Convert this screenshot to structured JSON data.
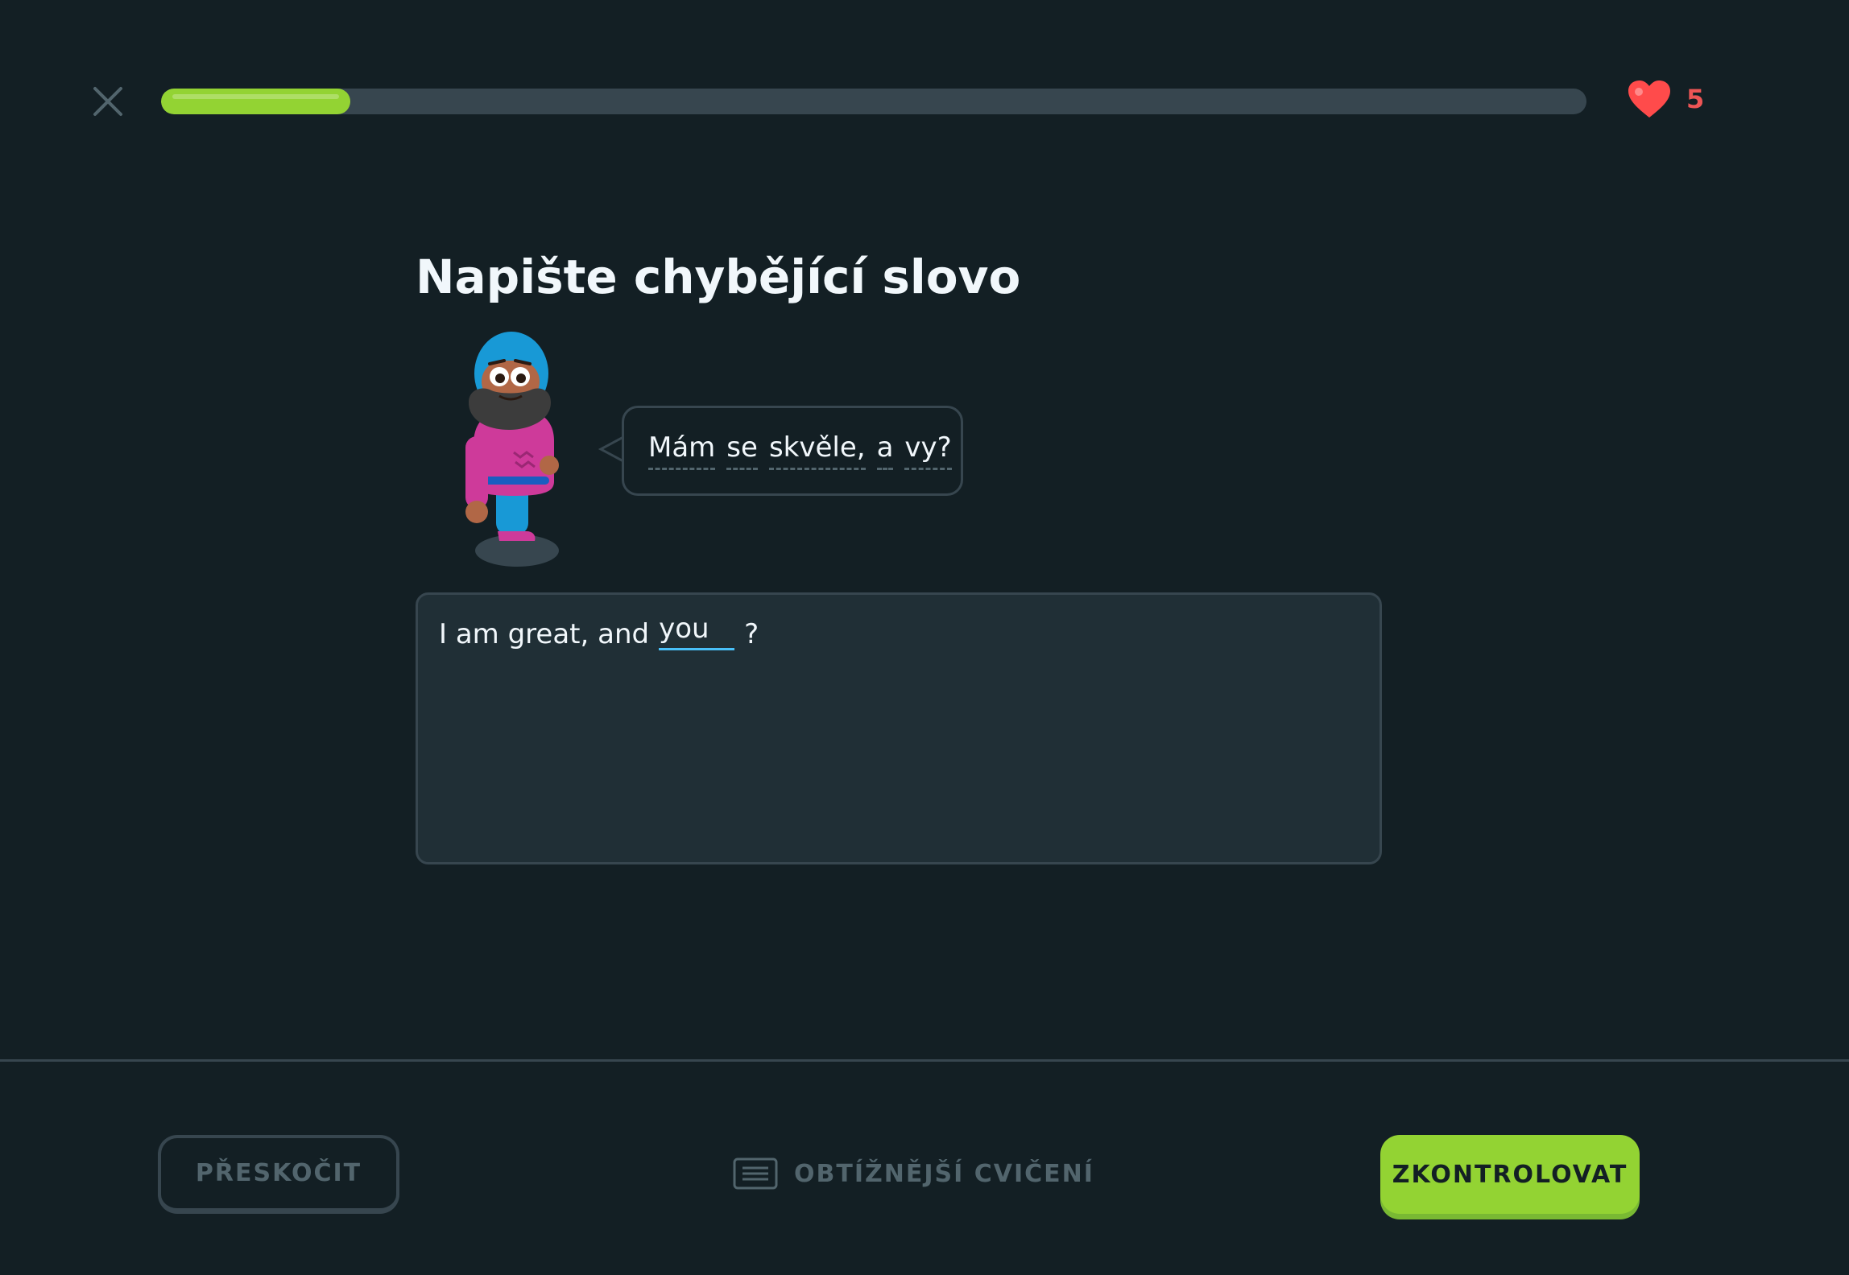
{
  "header": {
    "close_icon": "close-icon",
    "progress": 0.133,
    "hearts_icon": "heart-icon",
    "hearts_count": "5"
  },
  "exercise": {
    "title": "Napište chybějící slovo",
    "character": "character-illustration",
    "prompt_words": [
      "Mám",
      "se",
      "skvěle,",
      "a",
      "vy?"
    ],
    "answer_prefix": "I am great, and",
    "answer_value": "you",
    "answer_suffix": "?"
  },
  "footer": {
    "skip_label": "PŘESKOČIT",
    "harder_icon": "keyboard-icon",
    "harder_label": "OBTÍŽNĚJŠÍ CVIČENÍ",
    "check_label": "ZKONTROLOVAT"
  },
  "colors": {
    "background": "#131f24",
    "accent_green": "#93d333",
    "heart_red": "#ee5555",
    "input_blue": "#49c0f8",
    "border": "#37464f"
  }
}
